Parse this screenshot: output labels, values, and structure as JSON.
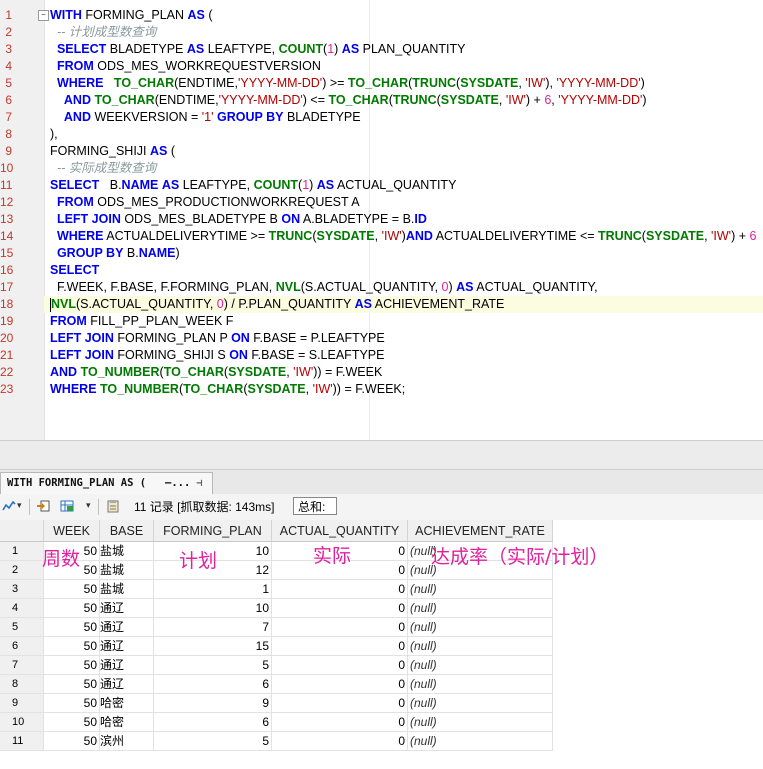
{
  "editor": {
    "line_numbers": [
      "1",
      "2",
      "3",
      "4",
      "5",
      "6",
      "7",
      "8",
      "9",
      "10",
      "11",
      "12",
      "13",
      "14",
      "15",
      "16",
      "17",
      "18",
      "19",
      "20",
      "21",
      "22",
      "23"
    ],
    "lines": [
      [
        [
          "kw",
          "WITH"
        ],
        [
          "p",
          " FORMING_PLAN "
        ],
        [
          "kw",
          "AS"
        ],
        [
          "p",
          " ("
        ]
      ],
      [
        [
          "p",
          "  "
        ],
        [
          "cm",
          "-- 计划成型数查询"
        ]
      ],
      [
        [
          "p",
          "  "
        ],
        [
          "kw",
          "SELECT"
        ],
        [
          "p",
          " BLADETYPE "
        ],
        [
          "kw",
          "AS"
        ],
        [
          "p",
          " LEAFTYPE, "
        ],
        [
          "fn",
          "COUNT"
        ],
        [
          "p",
          "("
        ],
        [
          "nm",
          "1"
        ],
        [
          "p",
          ") "
        ],
        [
          "kw",
          "AS"
        ],
        [
          "p",
          " PLAN_QUANTITY"
        ]
      ],
      [
        [
          "p",
          "  "
        ],
        [
          "kw",
          "FROM"
        ],
        [
          "p",
          " ODS_MES_WORKREQUESTVERSION"
        ]
      ],
      [
        [
          "p",
          "  "
        ],
        [
          "kw",
          "WHERE"
        ],
        [
          "p",
          "   "
        ],
        [
          "fn",
          "TO_CHAR"
        ],
        [
          "p",
          "(ENDTIME,"
        ],
        [
          "st",
          "'YYYY-MM-DD'"
        ],
        [
          "p",
          ") >= "
        ],
        [
          "fn",
          "TO_CHAR"
        ],
        [
          "p",
          "("
        ],
        [
          "fn",
          "TRUNC"
        ],
        [
          "p",
          "("
        ],
        [
          "fn",
          "SYSDATE"
        ],
        [
          "p",
          ", "
        ],
        [
          "st",
          "'IW'"
        ],
        [
          "p",
          "), "
        ],
        [
          "st",
          "'YYYY-MM-DD'"
        ],
        [
          "p",
          ")"
        ]
      ],
      [
        [
          "p",
          "    "
        ],
        [
          "kw",
          "AND"
        ],
        [
          "p",
          " "
        ],
        [
          "fn",
          "TO_CHAR"
        ],
        [
          "p",
          "(ENDTIME,"
        ],
        [
          "st",
          "'YYYY-MM-DD'"
        ],
        [
          "p",
          ") <= "
        ],
        [
          "fn",
          "TO_CHAR"
        ],
        [
          "p",
          "("
        ],
        [
          "fn",
          "TRUNC"
        ],
        [
          "p",
          "("
        ],
        [
          "fn",
          "SYSDATE"
        ],
        [
          "p",
          ", "
        ],
        [
          "st",
          "'IW'"
        ],
        [
          "p",
          ") + "
        ],
        [
          "nm",
          "6"
        ],
        [
          "p",
          ", "
        ],
        [
          "st",
          "'YYYY-MM-DD'"
        ],
        [
          "p",
          ")"
        ]
      ],
      [
        [
          "p",
          "    "
        ],
        [
          "kw",
          "AND"
        ],
        [
          "p",
          " WEEKVERSION = "
        ],
        [
          "st",
          "'1'"
        ],
        [
          "p",
          " "
        ],
        [
          "kw",
          "GROUP BY"
        ],
        [
          "p",
          " BLADETYPE"
        ]
      ],
      [
        [
          "p",
          "),"
        ]
      ],
      [
        [
          "p",
          "FORMING_SHIJI "
        ],
        [
          "kw",
          "AS"
        ],
        [
          "p",
          " ("
        ]
      ],
      [
        [
          "p",
          "  "
        ],
        [
          "cm",
          "-- 实际成型数查询"
        ]
      ],
      [
        [
          "kw",
          "SELECT"
        ],
        [
          "p",
          "   B."
        ],
        [
          "kw",
          "NAME"
        ],
        [
          "p",
          " "
        ],
        [
          "kw",
          "AS"
        ],
        [
          "p",
          " LEAFTYPE, "
        ],
        [
          "fn",
          "COUNT"
        ],
        [
          "p",
          "("
        ],
        [
          "nm",
          "1"
        ],
        [
          "p",
          ") "
        ],
        [
          "kw",
          "AS"
        ],
        [
          "p",
          " ACTUAL_QUANTITY"
        ]
      ],
      [
        [
          "p",
          "  "
        ],
        [
          "kw",
          "FROM"
        ],
        [
          "p",
          " ODS_MES_PRODUCTIONWORKREQUEST A"
        ]
      ],
      [
        [
          "p",
          "  "
        ],
        [
          "kw",
          "LEFT JOIN"
        ],
        [
          "p",
          " ODS_MES_BLADETYPE B "
        ],
        [
          "kw",
          "ON"
        ],
        [
          "p",
          " A.BLADETYPE = B."
        ],
        [
          "kw",
          "ID"
        ]
      ],
      [
        [
          "p",
          "  "
        ],
        [
          "kw",
          "WHERE"
        ],
        [
          "p",
          " ACTUALDELIVERYTIME >= "
        ],
        [
          "fn",
          "TRUNC"
        ],
        [
          "p",
          "("
        ],
        [
          "fn",
          "SYSDATE"
        ],
        [
          "p",
          ", "
        ],
        [
          "st",
          "'IW'"
        ],
        [
          "p",
          ")"
        ],
        [
          "kw",
          "AND"
        ],
        [
          "p",
          " ACTUALDELIVERYTIME <= "
        ],
        [
          "fn",
          "TRUNC"
        ],
        [
          "p",
          "("
        ],
        [
          "fn",
          "SYSDATE"
        ],
        [
          "p",
          ", "
        ],
        [
          "st",
          "'IW'"
        ],
        [
          "p",
          ") + "
        ],
        [
          "nm",
          "6"
        ]
      ],
      [
        [
          "p",
          "  "
        ],
        [
          "kw",
          "GROUP BY"
        ],
        [
          "p",
          " B."
        ],
        [
          "kw",
          "NAME"
        ],
        [
          "p",
          ")"
        ]
      ],
      [
        [
          "kw",
          "SELECT"
        ]
      ],
      [
        [
          "p",
          "  F.WEEK, F.BASE, F.FORMING_PLAN, "
        ],
        [
          "fn",
          "NVL"
        ],
        [
          "p",
          "(S.ACTUAL_QUANTITY, "
        ],
        [
          "nm",
          "0"
        ],
        [
          "p",
          ") "
        ],
        [
          "kw",
          "AS"
        ],
        [
          "p",
          " ACTUAL_QUANTITY,"
        ]
      ],
      [
        [
          "fn",
          "NVL"
        ],
        [
          "p",
          "(S.ACTUAL_QUANTITY, "
        ],
        [
          "nm",
          "0"
        ],
        [
          "p",
          ") / P.PLAN_QUANTITY "
        ],
        [
          "kw",
          "AS"
        ],
        [
          "p",
          " ACHIEVEMENT_RATE"
        ]
      ],
      [
        [
          "kw",
          "FROM"
        ],
        [
          "p",
          " FILL_PP_PLAN_WEEK F"
        ]
      ],
      [
        [
          "kw",
          "LEFT JOIN"
        ],
        [
          "p",
          " FORMING_PLAN P "
        ],
        [
          "kw",
          "ON"
        ],
        [
          "p",
          " F.BASE = P.LEAFTYPE"
        ]
      ],
      [
        [
          "kw",
          "LEFT JOIN"
        ],
        [
          "p",
          " FORMING_SHIJI S "
        ],
        [
          "kw",
          "ON"
        ],
        [
          "p",
          " F.BASE = S.LEAFTYPE"
        ]
      ],
      [
        [
          "kw",
          "AND"
        ],
        [
          "p",
          " "
        ],
        [
          "fn",
          "TO_NUMBER"
        ],
        [
          "p",
          "("
        ],
        [
          "fn",
          "TO_CHAR"
        ],
        [
          "p",
          "("
        ],
        [
          "fn",
          "SYSDATE"
        ],
        [
          "p",
          ", "
        ],
        [
          "st",
          "'IW'"
        ],
        [
          "p",
          ")) = F.WEEK"
        ]
      ],
      [
        [
          "kw",
          "WHERE"
        ],
        [
          "p",
          " "
        ],
        [
          "fn",
          "TO_NUMBER"
        ],
        [
          "p",
          "("
        ],
        [
          "fn",
          "TO_CHAR"
        ],
        [
          "p",
          "("
        ],
        [
          "fn",
          "SYSDATE"
        ],
        [
          "p",
          ", "
        ],
        [
          "st",
          "'IW'"
        ],
        [
          "p",
          ")) = F.WEEK;"
        ]
      ]
    ]
  },
  "result": {
    "tab_label": "WITH FORMING_PLAN AS (   —...",
    "status_text": "11 记录 [抓取数据: 143ms]",
    "sum_label": "总和:",
    "columns": [
      "WEEK",
      "BASE",
      "FORMING_PLAN",
      "ACTUAL_QUANTITY",
      "ACHIEVEMENT_RATE"
    ],
    "rows": [
      {
        "n": "1",
        "week": "50",
        "base": "盐城",
        "plan": "10",
        "actual": "0",
        "rate": "(null)"
      },
      {
        "n": "2",
        "week": "50",
        "base": "盐城",
        "plan": "12",
        "actual": "0",
        "rate": "(null)"
      },
      {
        "n": "3",
        "week": "50",
        "base": "盐城",
        "plan": "1",
        "actual": "0",
        "rate": "(null)"
      },
      {
        "n": "4",
        "week": "50",
        "base": "通辽",
        "plan": "10",
        "actual": "0",
        "rate": "(null)"
      },
      {
        "n": "5",
        "week": "50",
        "base": "通辽",
        "plan": "7",
        "actual": "0",
        "rate": "(null)"
      },
      {
        "n": "6",
        "week": "50",
        "base": "通辽",
        "plan": "15",
        "actual": "0",
        "rate": "(null)"
      },
      {
        "n": "7",
        "week": "50",
        "base": "通辽",
        "plan": "5",
        "actual": "0",
        "rate": "(null)"
      },
      {
        "n": "8",
        "week": "50",
        "base": "通辽",
        "plan": "6",
        "actual": "0",
        "rate": "(null)"
      },
      {
        "n": "9",
        "week": "50",
        "base": "哈密",
        "plan": "9",
        "actual": "0",
        "rate": "(null)"
      },
      {
        "n": "10",
        "week": "50",
        "base": "哈密",
        "plan": "6",
        "actual": "0",
        "rate": "(null)"
      },
      {
        "n": "11",
        "week": "50",
        "base": "滨州",
        "plan": "5",
        "actual": "0",
        "rate": "(null)"
      }
    ]
  },
  "annotations": {
    "week": "周数",
    "plan": "计划",
    "actual": "实际",
    "rate": "达成率（实际/计划）"
  },
  "colors": {
    "keyword": "#0000ee",
    "function": "#007a00",
    "string": "#b40000",
    "number": "#e0209e",
    "comment": "#8a9a9a",
    "annotation": "#e0209e"
  }
}
